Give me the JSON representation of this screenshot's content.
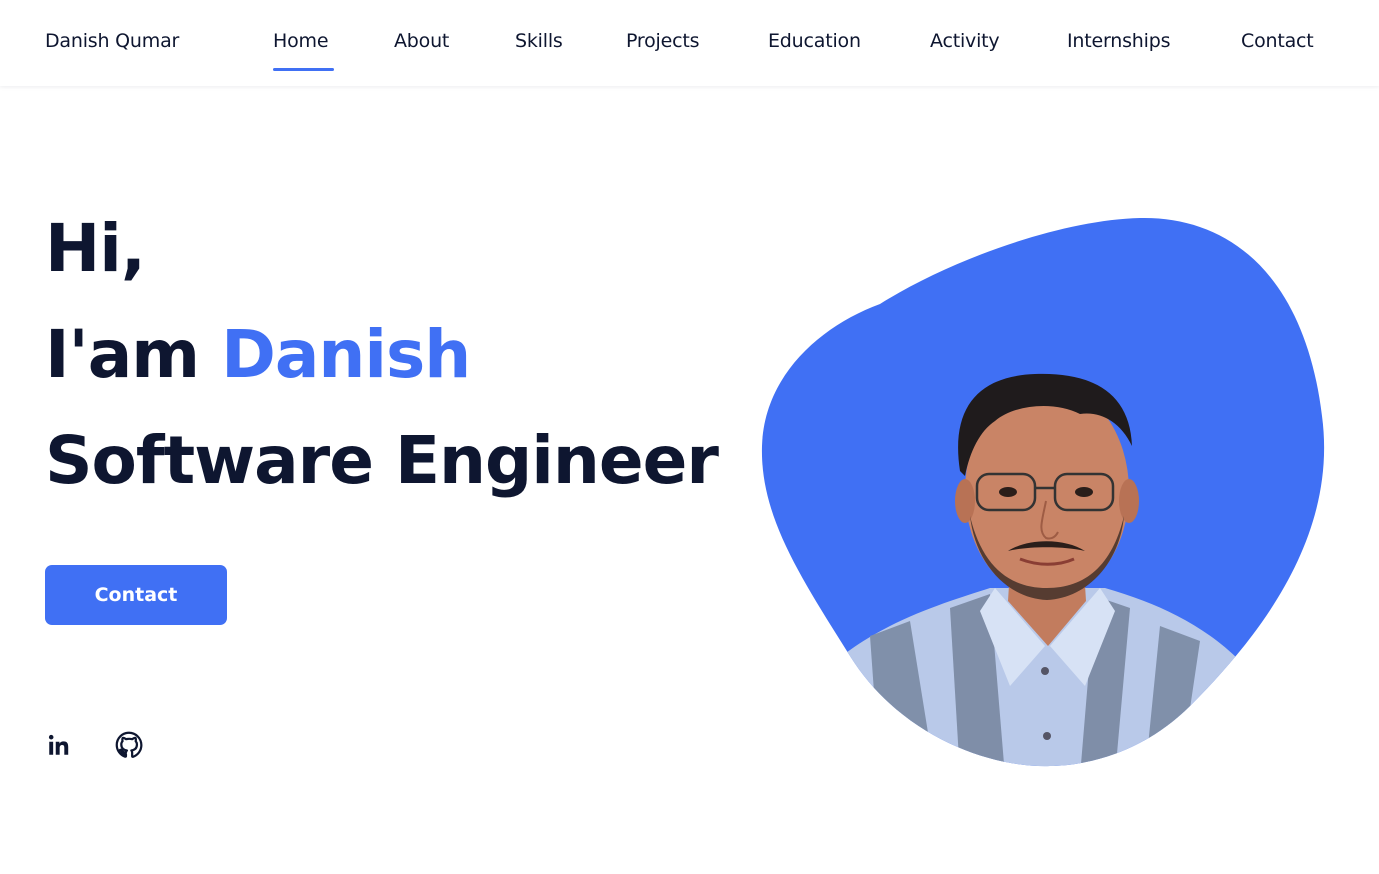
{
  "header": {
    "brand": "Danish Qumar",
    "nav": [
      "Home",
      "About",
      "Skills",
      "Projects",
      "Education",
      "Activity",
      "Internships",
      "Contact"
    ],
    "active": "Home"
  },
  "hero": {
    "line1": "Hi,",
    "line2_prefix": "I'am ",
    "line2_name": "Danish",
    "line3": "Software Engineer",
    "button_label": "Contact"
  },
  "social": {
    "icons": [
      "linkedin-icon",
      "github-icon"
    ]
  },
  "colors": {
    "accent": "#4070f4",
    "text": "#0e1630",
    "background": "#ffffff"
  }
}
